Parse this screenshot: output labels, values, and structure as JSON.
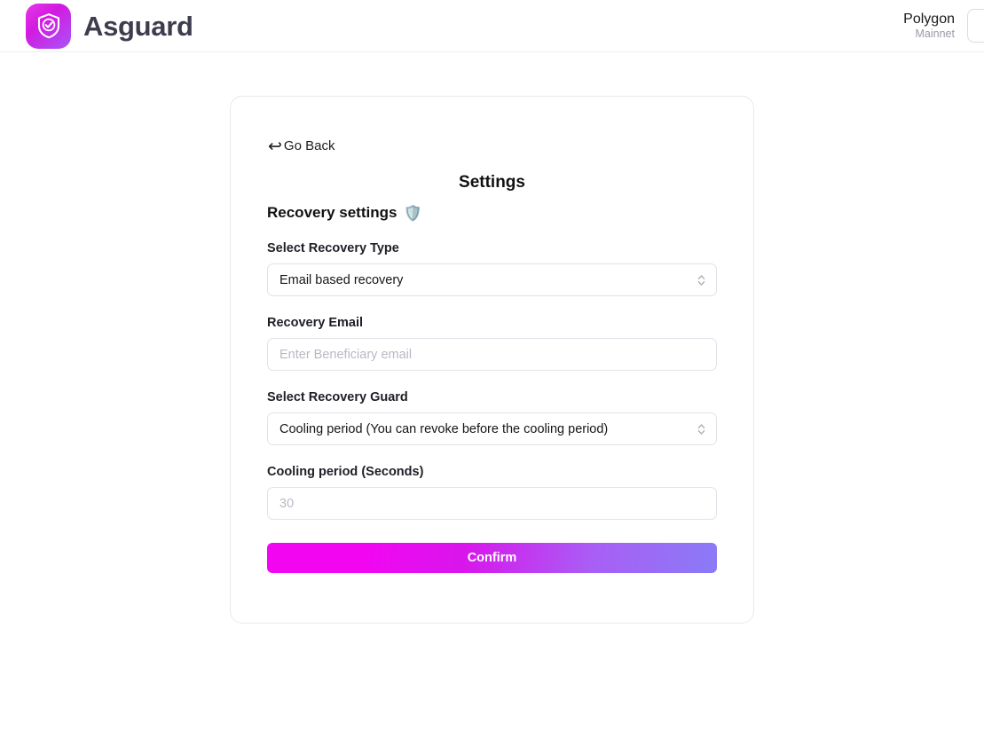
{
  "header": {
    "brand_name": "Asguard",
    "logo_icon": "shield-check-icon",
    "network": {
      "name": "Polygon",
      "environment": "Mainnet"
    },
    "account_chip_label": ""
  },
  "card": {
    "go_back": {
      "icon": "back-arrow-icon",
      "glyph": "↩",
      "label": "Go Back"
    },
    "page_title": "Settings",
    "section": {
      "title": "Recovery settings",
      "emoji": "🛡️"
    },
    "fields": [
      {
        "name": "recovery-type",
        "label": "Select Recovery Type",
        "type": "select",
        "value": "Email based recovery"
      },
      {
        "name": "recovery-email",
        "label": "Recovery Email",
        "type": "text",
        "value": "",
        "placeholder": "Enter Beneficiary email"
      },
      {
        "name": "recovery-guard",
        "label": "Select Recovery Guard",
        "type": "select",
        "value": "Cooling period (You can revoke before the cooling period)"
      },
      {
        "name": "cooling-period",
        "label": "Cooling period (Seconds)",
        "type": "text",
        "value": "",
        "placeholder": "30"
      }
    ],
    "confirm_label": "Confirm"
  },
  "colors": {
    "brand_magenta": "#f206f2",
    "brand_violet": "#8a7bf6",
    "border": "#e9e9ee",
    "muted_text": "#9a9aa5",
    "placeholder_text": "#b9b9c4"
  }
}
